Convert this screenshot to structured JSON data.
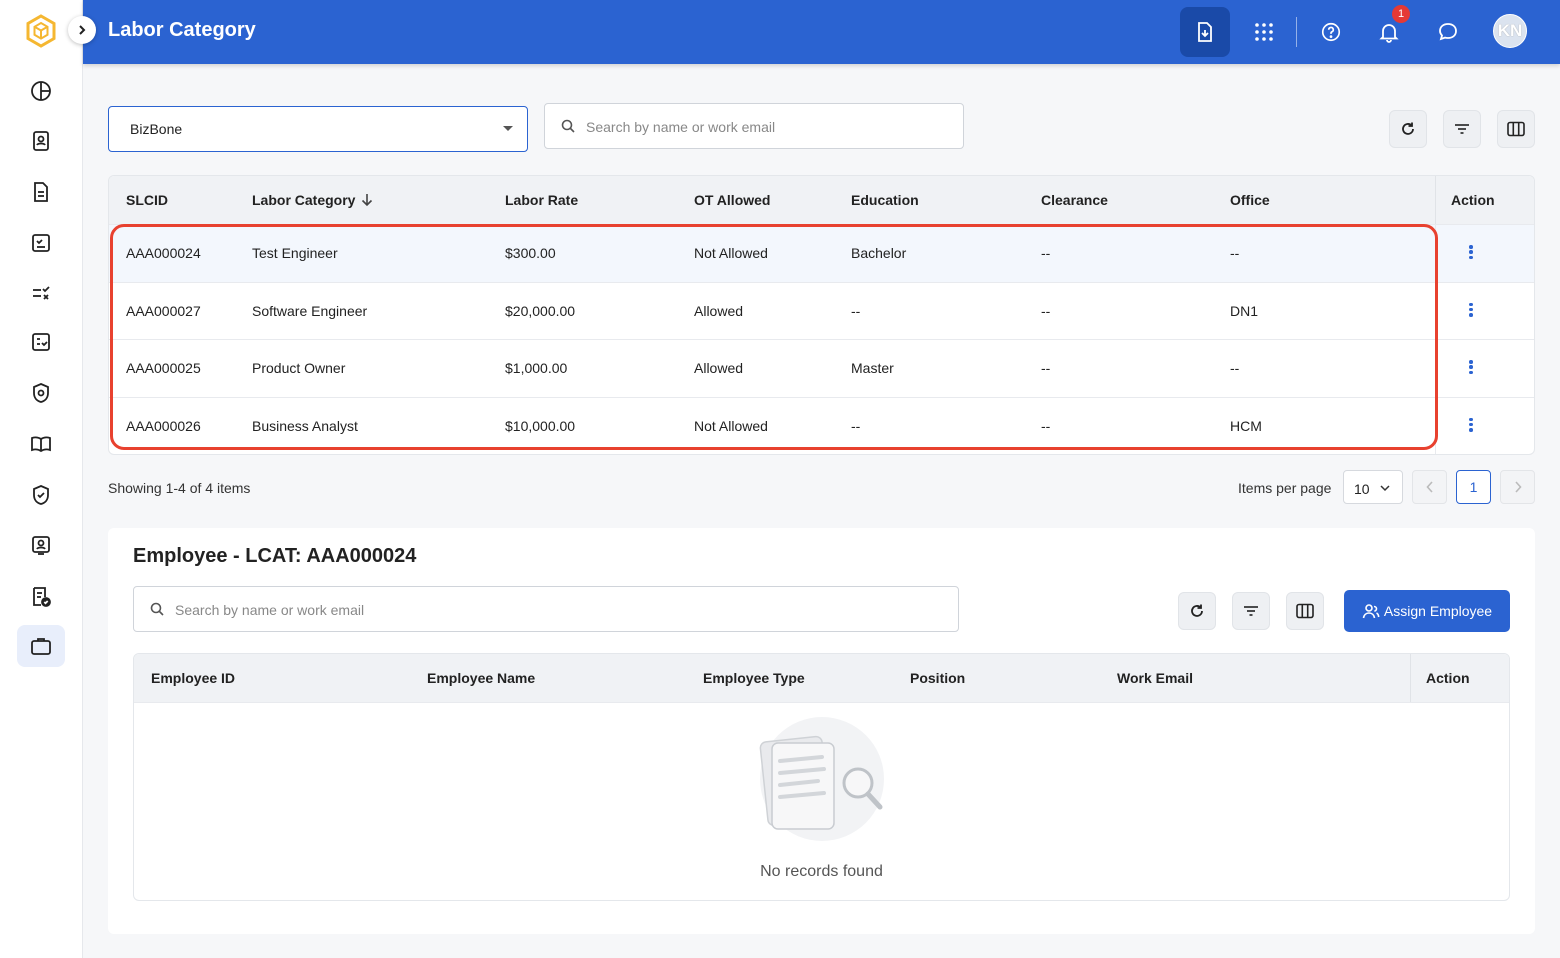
{
  "header": {
    "title": "Labor Category",
    "notification_count": "1",
    "avatar_initials": "KN"
  },
  "toolbar": {
    "company_select": "BizBone",
    "search_placeholder": "Search by name or work email"
  },
  "lcat_table": {
    "columns": [
      "SLCID",
      "Labor Category",
      "Labor Rate",
      "OT Allowed",
      "Education",
      "Clearance",
      "Office",
      "Action"
    ],
    "rows": [
      {
        "slcid": "AAA000024",
        "category": "Test Engineer",
        "rate": "$300.00",
        "ot": "Not Allowed",
        "education": "Bachelor",
        "clearance": "--",
        "office": "--"
      },
      {
        "slcid": "AAA000027",
        "category": "Software Engineer",
        "rate": "$20,000.00",
        "ot": "Allowed",
        "education": "--",
        "clearance": "--",
        "office": "DN1"
      },
      {
        "slcid": "AAA000025",
        "category": "Product Owner",
        "rate": "$1,000.00",
        "ot": "Allowed",
        "education": "Master",
        "clearance": "--",
        "office": "--"
      },
      {
        "slcid": "AAA000026",
        "category": "Business Analyst",
        "rate": "$10,000.00",
        "ot": "Not Allowed",
        "education": "--",
        "clearance": "--",
        "office": "HCM"
      }
    ]
  },
  "pagination": {
    "showing": "Showing 1-4 of 4 items",
    "items_per_page_label": "Items per page",
    "items_per_page": "10",
    "current_page": "1"
  },
  "employee_panel": {
    "title": "Employee - LCAT: AAA000024",
    "search_placeholder": "Search by name or work email",
    "assign_label": "Assign Employee",
    "columns": [
      "Employee ID",
      "Employee Name",
      "Employee Type",
      "Position",
      "Work Email",
      "Action"
    ],
    "empty_text": "No records found"
  },
  "colors": {
    "primary": "#2b63d1",
    "highlight": "#e8412f",
    "badge": "#e53935"
  }
}
